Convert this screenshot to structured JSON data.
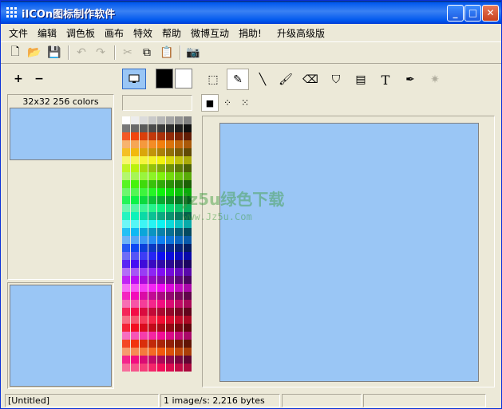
{
  "window": {
    "title": "iICOn图标制作软件"
  },
  "titlebar_buttons": {
    "minimize": "_",
    "maximize": "□",
    "close": "✕"
  },
  "menu": [
    "文件",
    "编辑",
    "调色板",
    "画布",
    "特效",
    "帮助",
    "微博互动",
    "捐助!",
    "升级高级版"
  ],
  "toolbar": {
    "icons": [
      "new-file-icon",
      "open-folder-icon",
      "save-icon",
      "undo-icon",
      "redo-icon",
      "cut-icon",
      "copy-icon",
      "paste-icon",
      "camera-icon"
    ],
    "glyphs": {
      "new": "🗋",
      "open": "📂",
      "save": "💾",
      "undo": "↶",
      "redo": "↷",
      "cut": "✂",
      "copy": "⧉",
      "paste": "📋",
      "camera": "📷"
    }
  },
  "size_controls": {
    "add": "+",
    "remove": "−"
  },
  "tools": {
    "glyphs": {
      "select": "⬚",
      "pencil": "✎",
      "line": "╲",
      "brush": "🖌",
      "eraser": "⌫",
      "fill": "⛉",
      "bucket": "▤",
      "text": "T",
      "picker": "✒",
      "wand": "✷"
    }
  },
  "brush_sizes": [
    "■",
    "⁘",
    "⁙"
  ],
  "preview": {
    "header": "32x32 256 colors"
  },
  "colors": {
    "foreground": "#000000",
    "background": "#ffffff",
    "canvas": "#9ac6f5"
  },
  "watermark": {
    "line1": "Jz5u绿色下载",
    "line2": "www.Jz5u.Com"
  },
  "status": {
    "filename": "[Untitled]",
    "info": "1 image/s: 2,216 bytes"
  }
}
